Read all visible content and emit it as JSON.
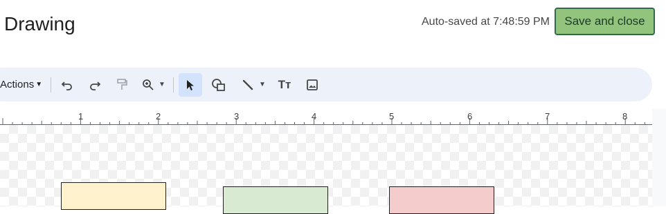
{
  "header": {
    "title": "Drawing",
    "autosave_text": "Auto-saved at 7:48:59 PM",
    "save_label": "Save and close"
  },
  "toolbar": {
    "actions_label": "Actions",
    "icons": [
      "undo-icon",
      "redo-icon",
      "paint-format-icon",
      "zoom-icon",
      "select-icon",
      "shape-icon",
      "line-icon",
      "text-box-icon",
      "image-icon"
    ],
    "text_box_glyph": "Tт"
  },
  "ruler": {
    "numbers": [
      "1",
      "2",
      "3",
      "4",
      "5",
      "6",
      "7",
      "8"
    ]
  },
  "canvas": {
    "shapes": [
      {
        "name": "yellow-rectangle",
        "fill": "#fff2cc"
      },
      {
        "name": "green-rectangle",
        "fill": "#d9ead3"
      },
      {
        "name": "red-rectangle",
        "fill": "#f4cccc"
      }
    ]
  },
  "colors": {
    "save_button_bg": "#93c47d",
    "save_button_border": "#2e6b46",
    "toolbar_bg": "#edf2fa",
    "selected_tool_bg": "#d3e3fd"
  }
}
